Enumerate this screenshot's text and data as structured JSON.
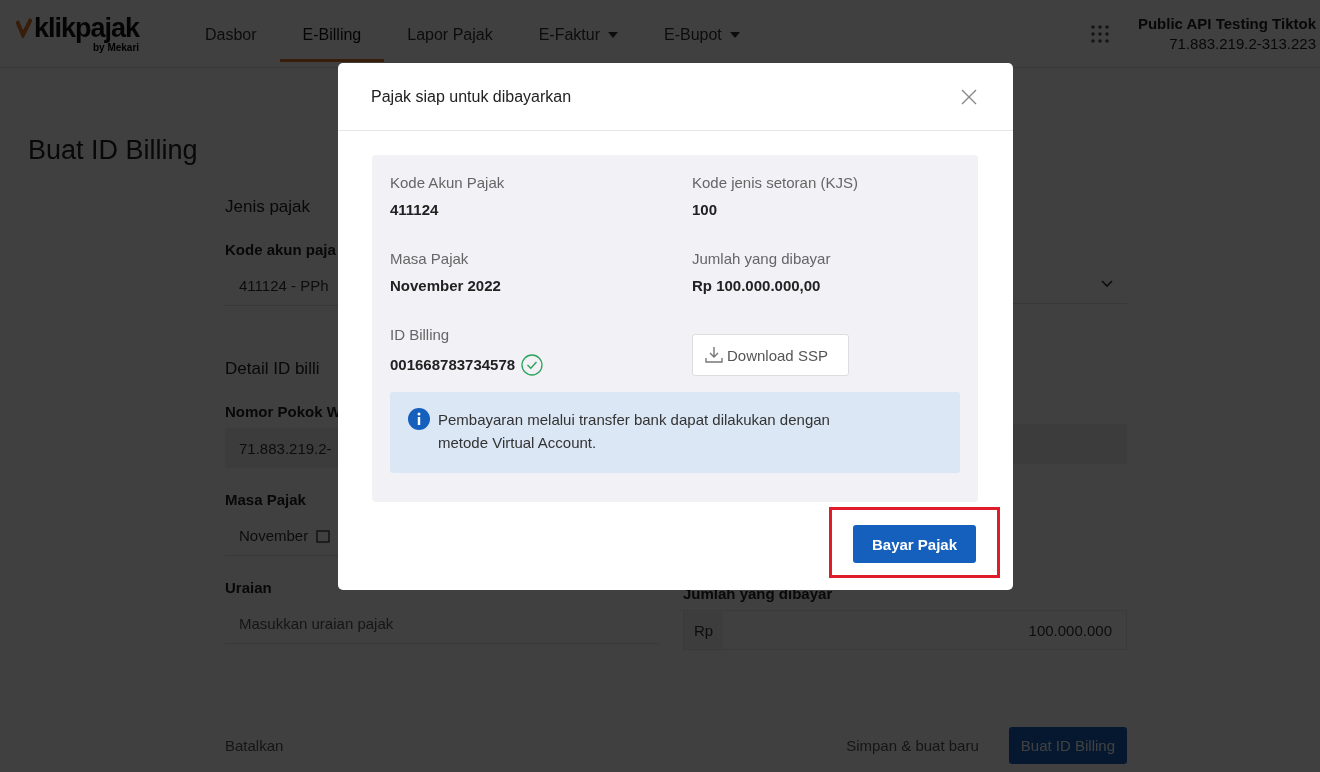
{
  "nav": {
    "logo": "klikpajak",
    "logo_sub": "by Mekari",
    "items": [
      {
        "label": "Dasbor",
        "selected": false,
        "dropdown": false
      },
      {
        "label": "E-Billing",
        "selected": true,
        "dropdown": false
      },
      {
        "label": "Lapor Pajak",
        "selected": false,
        "dropdown": false
      },
      {
        "label": "E-Faktur",
        "selected": false,
        "dropdown": true
      },
      {
        "label": "E-Bupot",
        "selected": false,
        "dropdown": true
      }
    ],
    "account": {
      "name": "Public API Testing Tiktok",
      "npwp": "71.883.219.2-313.223"
    }
  },
  "page_title": "Buat ID Billing",
  "tax_type": {
    "heading": "Jenis pajak",
    "account_label": "Kode akun paja",
    "account_value": "411124 - PPh"
  },
  "billing_detail": {
    "heading": "Detail ID billi",
    "npwp_label": "Nomor Pokok W",
    "npwp_value": "71.883.219.2-",
    "period_label": "Masa Pajak",
    "period_value": "November",
    "description_label": "Uraian",
    "description_placeholder": "Masukkan uraian pajak",
    "amount_label": "Jumlah yang dibayar",
    "currency": "Rp",
    "amount_value": "100.000.000"
  },
  "form_actions": {
    "cancel": "Batalkan",
    "save_new": "Simpan & buat baru",
    "submit": "Buat ID Billing"
  },
  "modal": {
    "title": "Pajak siap untuk dibayarkan",
    "details": [
      {
        "label": "Kode Akun Pajak",
        "value": "411124"
      },
      {
        "label": "Kode jenis setoran (KJS)",
        "value": "100"
      },
      {
        "label": "Masa Pajak",
        "value": "November 2022"
      },
      {
        "label": "Jumlah yang dibayar",
        "value": "Rp 100.000.000,00"
      }
    ],
    "billing_id": {
      "label": "ID Billing",
      "value": "001668783734578",
      "verified": true
    },
    "download_button": "Download SSP",
    "info": "Pembayaran melalui transfer bank dapat dilakukan dengan metode Virtual Account.",
    "pay_button": {
      "label": "Bayar Pajak",
      "highlighted": true
    }
  }
}
